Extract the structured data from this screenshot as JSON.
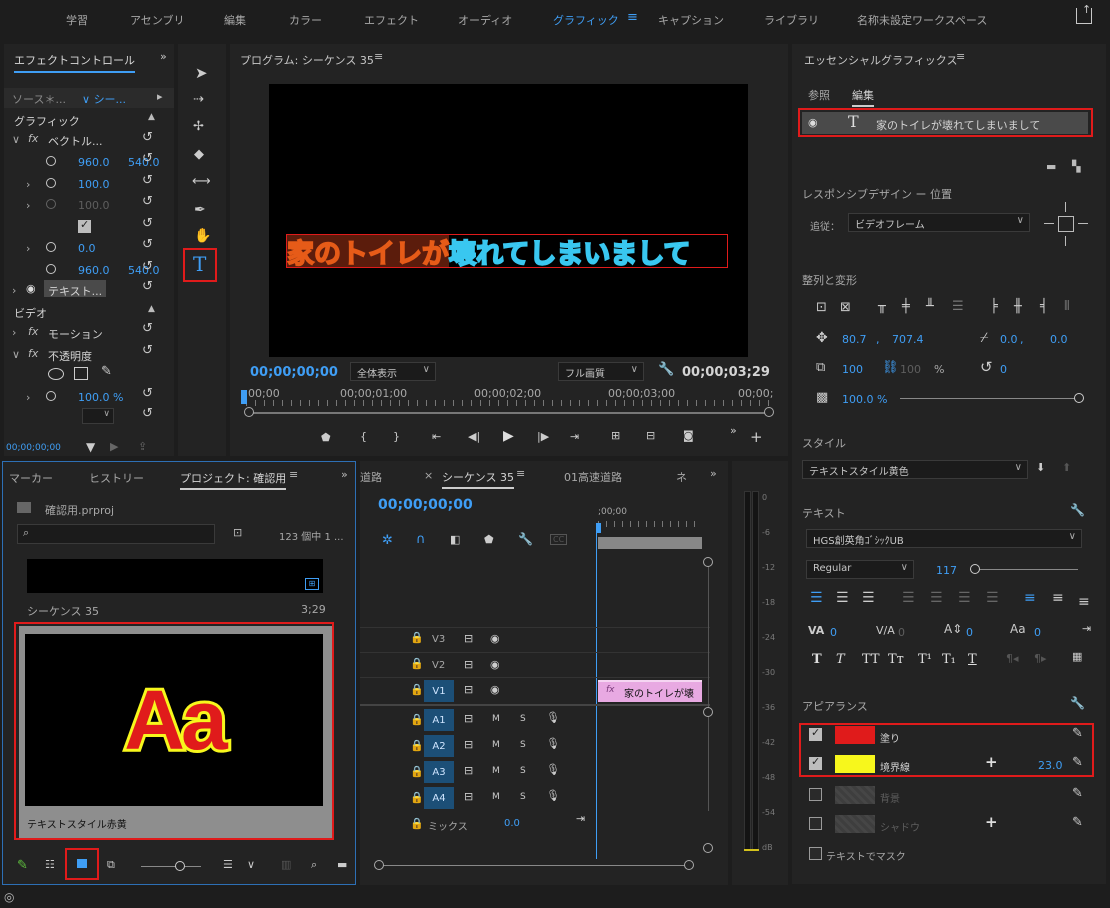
{
  "workspace_tabs": [
    "学習",
    "アセンブリ",
    "編集",
    "カラー",
    "エフェクト",
    "オーディオ",
    "グラフィック",
    "キャプション",
    "ライブラリ",
    "名称未設定ワークスペース"
  ],
  "active_workspace": "グラフィック",
  "effect_controls": {
    "title": "エフェクトコントロール",
    "source_label": "ソース＊...",
    "sequence_label": "シー...",
    "section_graphic": "グラフィック",
    "vector_label": "ベクトル...",
    "pos_x": "960.0",
    "pos_y": "540.0",
    "scale": "100.0",
    "scale_disabled": "100.0",
    "rotation": "0.0",
    "anchor_x": "960.0",
    "anchor_y": "540.0",
    "text_layer": "テキスト...",
    "section_video": "ビデオ",
    "motion_label": "モーション",
    "opacity_label": "不透明度",
    "opacity_value": "100.0 %",
    "timecode": "00;00;00;00"
  },
  "program_monitor": {
    "title": "プログラム: シーケンス 35",
    "caption_part1": "家のトイレが",
    "caption_part2": "壊れてしまいまして",
    "timecode": "00;00;00;00",
    "zoom": "全体表示",
    "quality": "フル画質",
    "duration": "00;00;03;29",
    "ruler": [
      "00;00",
      "00;00;01;00",
      "00;00;02;00",
      "00;00;03;00",
      "00;00;"
    ]
  },
  "project_panel": {
    "tabs": [
      "マーカー",
      "ヒストリー",
      "プロジェクト: 確認用"
    ],
    "project_file": "確認用.prproj",
    "item_count": "123 個中 1 ...",
    "sequence_name": "シーケンス 35",
    "sequence_duration": "3;29",
    "thumb_text": "Aa",
    "style_name": "テキストスタイル赤黄"
  },
  "timeline": {
    "tabs": [
      "道路",
      "シーケンス 35",
      "01高速道路",
      "ネ"
    ],
    "timecode": "00;00;00;00",
    "ruler_start": ";00;00",
    "tracks_video": [
      "V3",
      "V2",
      "V1"
    ],
    "tracks_audio": [
      "A1",
      "A2",
      "A3",
      "A4"
    ],
    "mix_label": "ミックス",
    "mix_value": "0.0",
    "clip_label": "家のトイレが壊",
    "meter_scale": [
      "0",
      "-6",
      "-12",
      "-18",
      "-24",
      "-30",
      "-36",
      "-42",
      "-48",
      "-54",
      "dB"
    ]
  },
  "essential_graphics": {
    "title": "エッセンシャルグラフィックス",
    "tab_browse": "参照",
    "tab_edit": "編集",
    "layer_name": "家のトイレが壊れてしまいまして",
    "responsive_title": "レスポンシブデザイン ー 位置",
    "pin_label": "追従：",
    "pin_value": "ビデオフレーム",
    "align_title": "整列と変形",
    "pos_x": "80.7",
    "pos_y": "707.4",
    "anchor_x": "0.0",
    "anchor_y": "0.0",
    "scale": "100",
    "scale_locked": "100",
    "scale_unit": "%",
    "rotation": "0",
    "opacity": "100.0 %",
    "style_title": "スタイル",
    "style_value": "テキストスタイル黄色",
    "text_title": "テキスト",
    "font_family": "HGS創英角ｺﾞｼｯｸUB",
    "font_style": "Regular",
    "font_size": "117",
    "tracking": "0",
    "kerning": "0",
    "leading": "0",
    "baseline": "0",
    "appearance_title": "アピアランス",
    "fill_label": "塗り",
    "stroke_label": "境界線",
    "stroke_width": "23.0",
    "background_label": "背景",
    "shadow_label": "シャドウ",
    "mask_label": "テキストでマスク"
  },
  "colors": {
    "accent": "#3f9ef5",
    "fill": "#e01b1b",
    "stroke": "#f7f71c",
    "highlight": "#e01b1b"
  }
}
